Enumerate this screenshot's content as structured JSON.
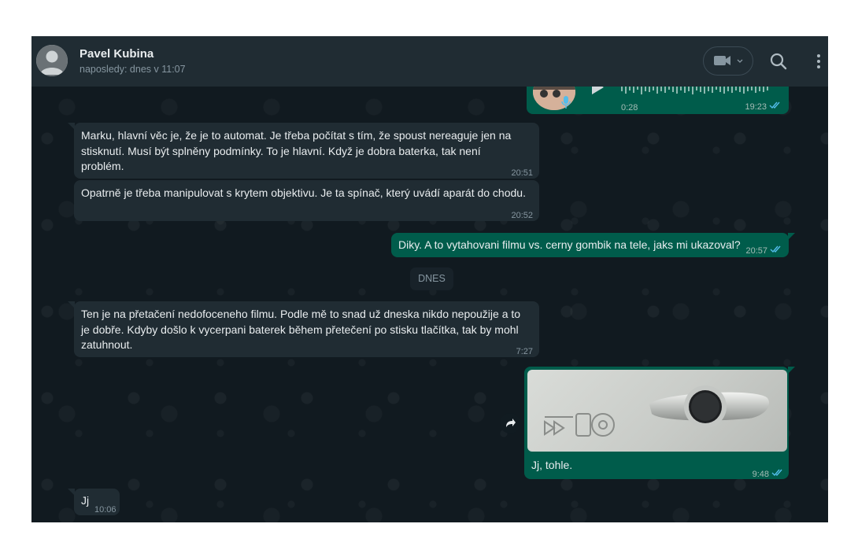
{
  "header": {
    "contact_name": "Pavel Kubina",
    "status": "naposledy: dnes v 11:07",
    "icons": [
      "avatar-placeholder",
      "video-call-icon",
      "search-icon",
      "menu-icon"
    ]
  },
  "messages": [
    {
      "direction": "out",
      "type": "voice",
      "duration": "0:28",
      "time": "19:23",
      "read": true
    },
    {
      "direction": "in",
      "text_lines": [
        "Marku, hlavní věc je, že je to automat.  Je třeba počítat s tím, že spoust nereaguje jen na",
        "stisknutí. Musí být splněny podmínky.  To je hlavní.  Když je dobra baterka, tak není",
        "problém."
      ],
      "time": "20:51"
    },
    {
      "direction": "in",
      "text_lines": [
        "Opatrně je třeba manipulovat s krytem objektivu. Je ta spínač,  který uvádí aparát do chodu."
      ],
      "time": "20:52"
    },
    {
      "direction": "out",
      "text_lines": [
        "Diky. A to vytahovani filmu vs. cerny gombik na tele, jaks mi ukazoval?"
      ],
      "time": "20:57",
      "read": true
    },
    {
      "direction": "in",
      "text_lines": [
        "Ten je na přetačení nedofoceneho filmu.  Podle mě to snad už dneska nikdo nepoužije a to",
        "je dobře. Kdyby došlo k vycerpani baterek během přetečení po stisku tlačítka,  tak by mohl",
        "zatuhnout."
      ],
      "time": "7:27"
    },
    {
      "direction": "out",
      "type": "image",
      "caption": "Jj, tohle.",
      "time": "9:48",
      "read": true
    },
    {
      "direction": "in",
      "text_lines": [
        "Jj"
      ],
      "time": "10:06"
    }
  ],
  "day_separator": "DNES",
  "colors": {
    "header_bg": "#202c33",
    "incoming_bubble": "#202c33",
    "outgoing_bubble": "#005c4b",
    "read_ticks": "#53bdeb",
    "text": "#e9edef",
    "meta": "#8696a0"
  }
}
